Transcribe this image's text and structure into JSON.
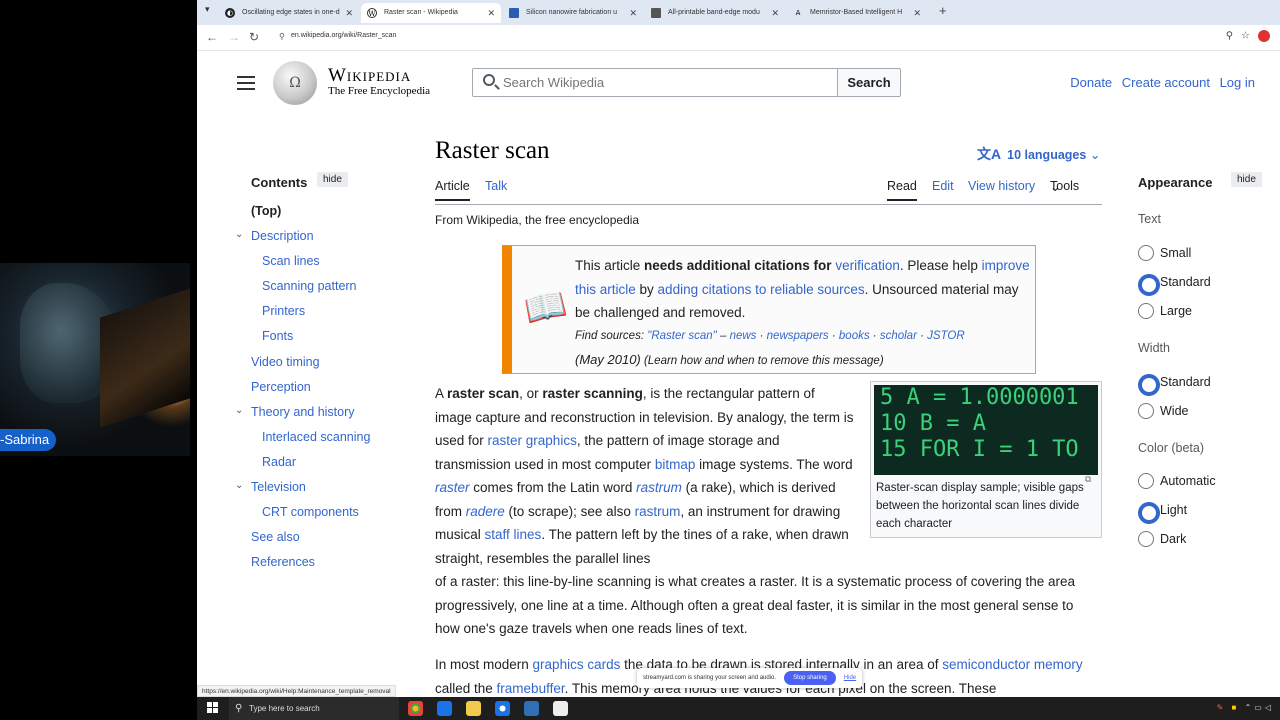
{
  "webcam": {
    "name": "-Sabrina"
  },
  "browser": {
    "tabs": [
      {
        "label": "Oscillating edge states in one-d",
        "active": false
      },
      {
        "label": "Raster scan - Wikipedia",
        "active": true
      },
      {
        "label": "Silicon nanowire fabrication u",
        "active": false
      },
      {
        "label": "All-printable band-edge modu",
        "active": false
      },
      {
        "label": "Memristor-Based Intelligent H",
        "active": false
      }
    ],
    "new_tab": "+",
    "url": "en.wikipedia.org/wiki/Raster_scan"
  },
  "wiki": {
    "logo_wordmark": "Wikipedia",
    "logo_tagline": "The Free Encyclopedia",
    "search_placeholder": "Search Wikipedia",
    "search_button": "Search",
    "header_links": {
      "donate": "Donate",
      "create_account": "Create account",
      "log_in": "Log in"
    },
    "toc": {
      "heading": "Contents",
      "hide": "hide",
      "items": [
        {
          "label": "(Top)",
          "level": 0
        },
        {
          "label": "Description",
          "level": 1,
          "caret": true
        },
        {
          "label": "Scan lines",
          "level": 2
        },
        {
          "label": "Scanning pattern",
          "level": 2
        },
        {
          "label": "Printers",
          "level": 2
        },
        {
          "label": "Fonts",
          "level": 2
        },
        {
          "label": "Video timing",
          "level": 1
        },
        {
          "label": "Perception",
          "level": 1
        },
        {
          "label": "Theory and history",
          "level": 1,
          "caret": true
        },
        {
          "label": "Interlaced scanning",
          "level": 2
        },
        {
          "label": "Radar",
          "level": 2
        },
        {
          "label": "Television",
          "level": 1,
          "caret": true
        },
        {
          "label": "CRT components",
          "level": 2
        },
        {
          "label": "See also",
          "level": 1
        },
        {
          "label": "References",
          "level": 1
        }
      ]
    },
    "title": "Raster scan",
    "languages": "10 languages",
    "tabs": {
      "article": "Article",
      "talk": "Talk",
      "read": "Read",
      "edit": "Edit",
      "view_history": "View history",
      "tools": "Tools"
    },
    "from": "From Wikipedia, the free encyclopedia",
    "ambox": {
      "p1": "This article ",
      "p1_bold": "needs additional citations for ",
      "p1_link": "verification",
      "p2": ". Please help ",
      "p2_link": "improve this article",
      "p3": " by ",
      "p3_link": "adding citations to reliable sources",
      "p4": ". Unsourced material may be challenged and removed.",
      "find_label": "Find sources: ",
      "find_q": "\"Raster scan\"",
      "find_sep1": " – ",
      "find_news": "news",
      "find_newspapers": "newspapers",
      "find_books": "books",
      "find_scholar": "scholar",
      "find_jstor": "JSTOR",
      "dot": " · ",
      "date": "(May 2010)",
      "learn": "(Learn how and when to remove this message)"
    },
    "lead": {
      "a": "A ",
      "b1": "raster scan",
      "c": ", or ",
      "b2": "raster scanning",
      "d": ", is the rectangular pattern of image capture and reconstruction in television. By analogy, the term is used for ",
      "l1": "raster graphics",
      "e": ", the pattern of image storage and transmission used in most computer ",
      "l2": "bitmap",
      "f": " image systems. The word ",
      "i1": "raster",
      "g": " comes from the Latin word ",
      "i2": "rastrum",
      "h": " (a rake), which is derived from ",
      "i3": "radere",
      "i": " (to scrape); see also ",
      "l3": "rastrum",
      "j": ", an instrument for drawing musical ",
      "l4": "staff lines",
      "k": ". The pattern left by the tines of a rake, when drawn straight, resembles the parallel lines",
      "cont": "of a raster: this line-by-line scanning is what creates a raster. It is a systematic process of covering the area progressively, one line at a time. Although often a great deal faster, it is similar in the most general sense to how one's gaze travels when one reads lines of text."
    },
    "para2": {
      "a": "In most modern ",
      "l1": "graphics cards",
      "b": " the data to be drawn is stored internally in an area of ",
      "l2": "semiconductor memory",
      "c": " called the ",
      "l3": "framebuffer",
      "d": ". This memory area holds the values for each pixel on the screen. These"
    },
    "figure": {
      "screen_lines": [
        "5 A = 1.0000001",
        "10 B = A",
        "15 FOR I = 1 TO"
      ],
      "caption": "Raster-scan display sample; visible gaps between the horizontal scan lines divide each character"
    },
    "appearance": {
      "heading": "Appearance",
      "hide": "hide",
      "text_label": "Text",
      "text_options": [
        "Small",
        "Standard",
        "Large"
      ],
      "text_selected": "Standard",
      "width_label": "Width",
      "width_options": [
        "Standard",
        "Wide"
      ],
      "width_selected": "Standard",
      "color_label": "Color (beta)",
      "color_options": [
        "Automatic",
        "Light",
        "Dark"
      ],
      "color_selected": "Light"
    }
  },
  "status_url": "https://en.wikipedia.org/wiki/Help:Maintenance_template_removal",
  "share_bar": {
    "text": "streamyard.com is sharing your screen and audio.",
    "stop": "Stop sharing",
    "hide": "Hide"
  },
  "taskbar": {
    "search_placeholder": "Type here to search"
  },
  "colors": {
    "link": "#3366cc",
    "ambox_accent": "#f28500",
    "share_button": "#4a61f2",
    "name_badge": "#1560c9"
  }
}
